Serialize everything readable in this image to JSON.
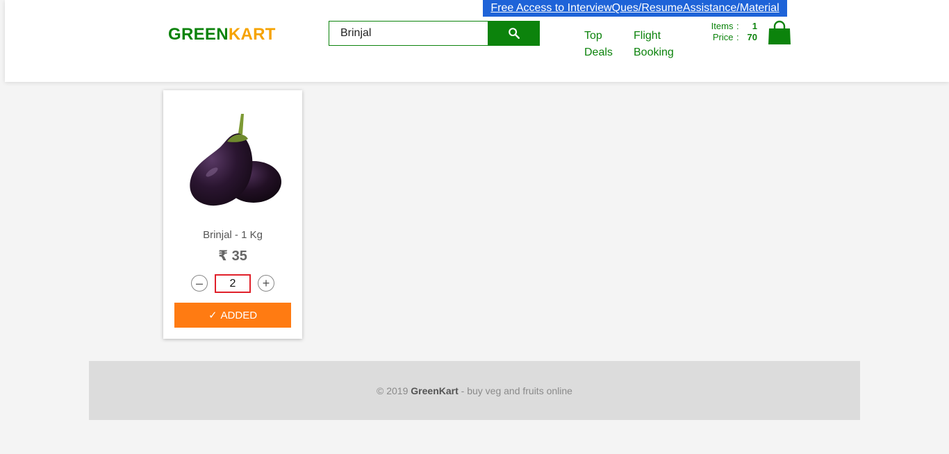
{
  "header": {
    "promo_link": "Free Access to InterviewQues/ResumeAssistance/Material",
    "logo_part1": "GREEN",
    "logo_part2": "KART",
    "search": {
      "value": "Brinjal",
      "icon": "search-icon"
    },
    "nav": {
      "top_deals": "Top Deals",
      "flight_booking": "Flight Booking"
    },
    "cart": {
      "items_label": "Items",
      "items_value": "1",
      "price_label": "Price",
      "price_value": "70",
      "separator": ":",
      "icon": "shopping-bag-icon"
    }
  },
  "products": [
    {
      "name": "Brinjal - 1 Kg",
      "price": "₹ 35",
      "quantity": "2",
      "decrement": "–",
      "increment": "+",
      "button_check": "✓",
      "button_label": "ADDED",
      "image_icon": "brinjal-image"
    }
  ],
  "footer": {
    "prefix": "© 2019 ",
    "brand": "GreenKart",
    "suffix": " - buy veg and fruits online"
  },
  "colors": {
    "brand_green": "#0c830c",
    "brand_orange": "#f6a300",
    "button_orange": "#ff7b12",
    "promo_blue": "#1e63d8",
    "qty_border_red": "#e0202a"
  }
}
